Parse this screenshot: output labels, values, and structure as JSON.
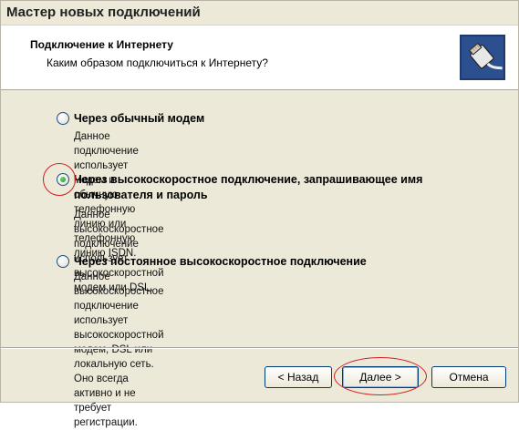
{
  "window": {
    "title": "Мастер новых подключений"
  },
  "header": {
    "title": "Подключение к Интернету",
    "subtitle": "Каким образом подключиться к Интернету?",
    "icon": "network-cable-icon"
  },
  "options": [
    {
      "label": "Через обычный модем",
      "description": [
        "Данное подключение использует модем и обычную телефонную линию или",
        "телефонную линию ISDN."
      ],
      "selected": false
    },
    {
      "label_lines": [
        "Через высокоскоростное подключение, запрашивающее имя",
        "пользователя и пароль"
      ],
      "description": [
        "Данное высокоскоростное подключение использует высокоскоростной",
        "модем или DSL."
      ],
      "selected": true
    },
    {
      "label": "Через постоянное высокоскоростное подключение",
      "description": [
        "Данное высокоскоростное подключение использует высокоскоростной",
        "модем, DSL или локальную сеть. Оно всегда активно и не требует",
        "регистрации."
      ],
      "selected": false
    }
  ],
  "buttons": {
    "back": "< Назад",
    "next": "Далее >",
    "cancel": "Отмена"
  },
  "colors": {
    "annotation": "#d02020",
    "selected_radio": "#1b9a1b"
  }
}
